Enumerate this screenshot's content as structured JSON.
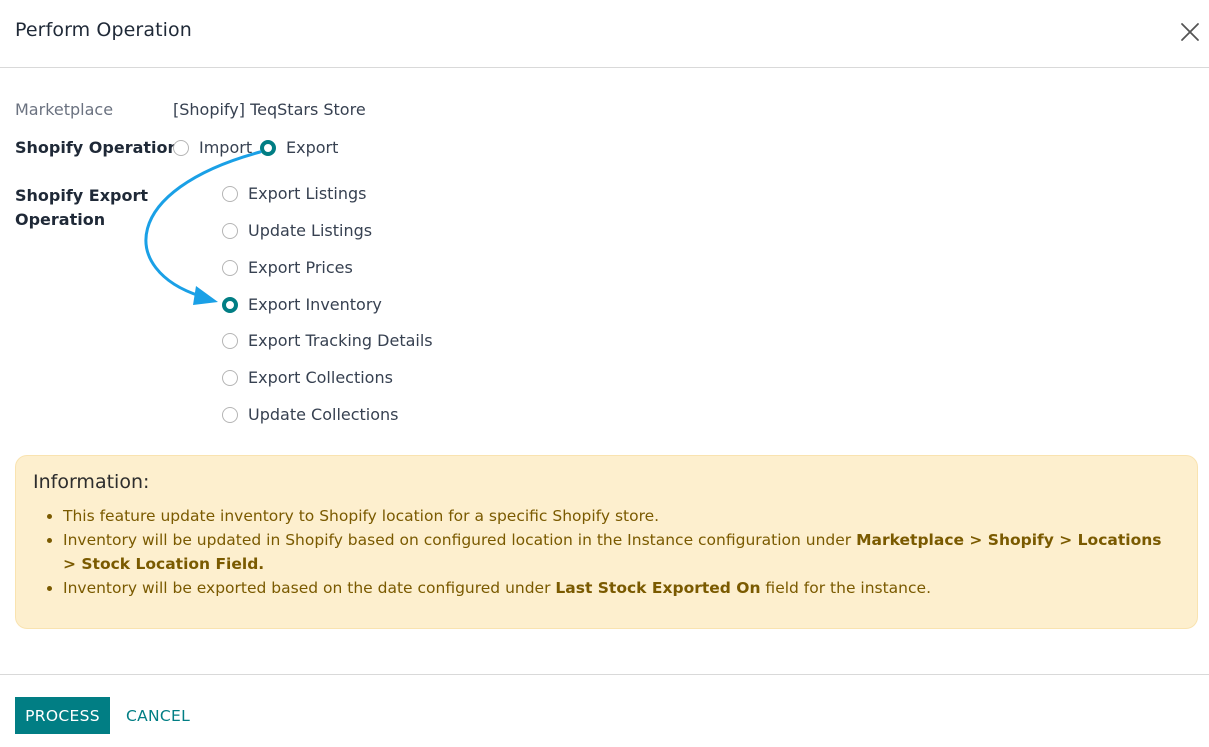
{
  "dialog": {
    "title": "Perform Operation"
  },
  "form": {
    "marketplace_label": "Marketplace",
    "marketplace_value": "[Shopify] TeqStars Store",
    "operation_label": "Shopify Operation",
    "operation_options": [
      {
        "label": "Import",
        "checked": false
      },
      {
        "label": "Export",
        "checked": true
      }
    ],
    "export_operation_label_line1": "Shopify Export",
    "export_operation_label_line2": "Operation",
    "export_options": [
      {
        "label": "Export Listings",
        "checked": false
      },
      {
        "label": "Update Listings",
        "checked": false
      },
      {
        "label": "Export Prices",
        "checked": false
      },
      {
        "label": "Export Inventory",
        "checked": true
      },
      {
        "label": "Export Tracking Details",
        "checked": false
      },
      {
        "label": "Export Collections",
        "checked": false
      },
      {
        "label": "Update Collections",
        "checked": false
      }
    ]
  },
  "info": {
    "title": "Information:",
    "items": [
      {
        "text": "This feature update inventory to Shopify location for a specific Shopify store."
      },
      {
        "text_before": "Inventory will be updated in Shopify based on configured location in the Instance configuration under ",
        "bold": "Marketplace > Shopify > Locations > Stock Location Field."
      },
      {
        "text_before": "Inventory will be exported based on the date configured under ",
        "bold": "Last Stock Exported On",
        "text_after": " field for the instance."
      }
    ]
  },
  "footer": {
    "process_label": "PROCESS",
    "cancel_label": "CANCEL"
  },
  "colors": {
    "accent": "#017e84",
    "info_background": "#fdefce",
    "info_text": "#7a5a00",
    "annotation_arrow": "#1aa0e6"
  }
}
